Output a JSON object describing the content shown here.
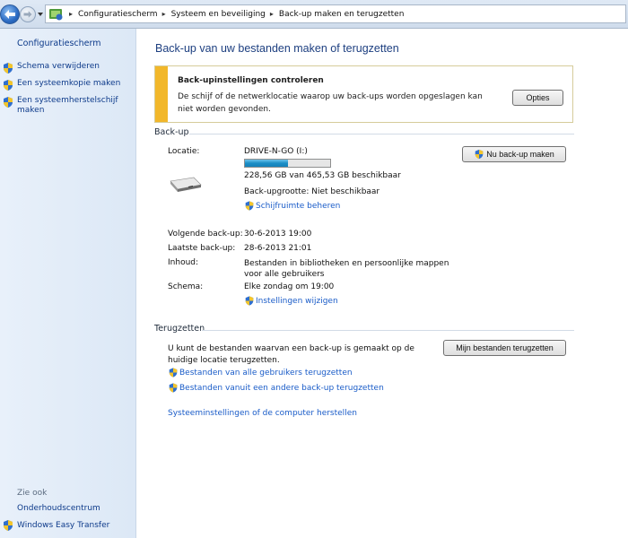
{
  "addressbar": {
    "breadcrumbs": [
      "Configuratiescherm",
      "Systeem en beveiliging",
      "Back-up maken en terugzetten"
    ]
  },
  "sidebar": {
    "home": "Configuratiescherm",
    "links": [
      {
        "label": "Schema verwijderen",
        "icon": "shield-icon"
      },
      {
        "label": "Een systeemkopie maken",
        "icon": "shield-icon"
      },
      {
        "label": "Een systeemherstelschijf maken",
        "icon": "shield-icon"
      }
    ],
    "see_also": "Zie ook",
    "see_links": [
      "Onderhoudscentrum",
      "Windows Easy Transfer"
    ]
  },
  "main": {
    "title": "Back-up van uw bestanden maken of terugzetten",
    "notice": {
      "title": "Back-upinstellingen controleren",
      "text": "De schijf of de netwerklocatie waarop uw back-ups worden opgeslagen kan niet worden gevonden.",
      "button": "Opties",
      "color": "#f2b72a"
    },
    "backup": {
      "heading": "Back-up",
      "location_label": "Locatie:",
      "location_value": "DRIVE-N-GO (I:)",
      "space_text": "228,56 GB van 465,53 GB beschikbaar",
      "space_fraction": 0.51,
      "size_text": "Back-upgrootte: Niet beschikbaar",
      "manage_space_link": "Schijfruimte beheren",
      "backup_now_button": "Nu back-up maken",
      "next_label": "Volgende back-up:",
      "next_value": "30-6-2013 19:00",
      "last_label": "Laatste back-up:",
      "last_value": "28-6-2013 21:01",
      "contents_label": "Inhoud:",
      "contents_value": "Bestanden in bibliotheken en persoonlijke mappen voor alle gebruikers",
      "schedule_label": "Schema:",
      "schedule_value": "Elke zondag om 19:00",
      "change_settings_link": "Instellingen wijzigen"
    },
    "restore": {
      "heading": "Terugzetten",
      "text": "U kunt de bestanden waarvan een back-up is gemaakt op de huidige locatie terugzetten.",
      "restore_button": "Mijn bestanden terugzetten",
      "all_users_link": "Bestanden van alle gebruikers terugzetten",
      "other_backup_link": "Bestanden vanuit een andere back-up terugzetten",
      "system_link": "Systeeminstellingen of de computer herstellen"
    }
  }
}
